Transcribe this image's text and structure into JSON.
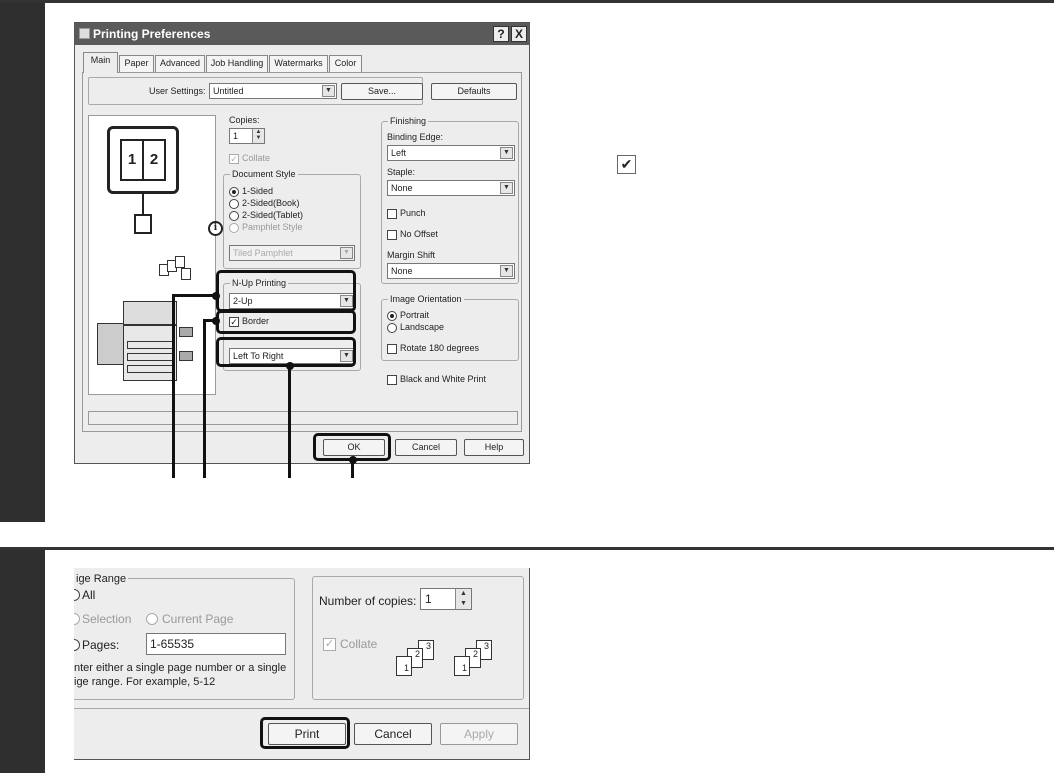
{
  "dialog1": {
    "title": "Printing Preferences",
    "help_button": "?",
    "close_button": "X",
    "tabs": [
      "Main",
      "Paper",
      "Advanced",
      "Job Handling",
      "Watermarks",
      "Color"
    ],
    "user_settings_label": "User Settings:",
    "user_settings_value": "Untitled",
    "save_button": "Save...",
    "defaults_button": "Defaults",
    "preview_pages": [
      "1",
      "2"
    ],
    "copies_label": "Copies:",
    "copies_value": "1",
    "collate_label": "Collate",
    "document_style_label": "Document Style",
    "document_style_options": [
      "1-Sided",
      "2-Sided(Book)",
      "2-Sided(Tablet)",
      "Pamphlet Style"
    ],
    "pamphlet_value": "Tiled Pamphlet",
    "info_icon_glyph": "i",
    "nup_label": "N-Up Printing",
    "nup_value": "2-Up",
    "border_label": "Border",
    "order_value": "Left To Right",
    "finishing_label": "Finishing",
    "binding_edge_label": "Binding Edge:",
    "binding_edge_value": "Left",
    "staple_label": "Staple:",
    "staple_value": "None",
    "punch_label": "Punch",
    "no_offset_label": "No Offset",
    "margin_shift_label": "Margin Shift",
    "margin_shift_value": "None",
    "orientation_label": "Image Orientation",
    "portrait_label": "Portrait",
    "landscape_label": "Landscape",
    "rotate_label": "Rotate 180 degrees",
    "bw_label": "Black and White Print",
    "ok_button": "OK",
    "cancel_button": "Cancel",
    "help_bottom_button": "Help"
  },
  "floating_check": "✔",
  "dialog2": {
    "page_range_label": "ige Range",
    "all_label": "All",
    "selection_label": "Selection",
    "current_page_label": "Current Page",
    "pages_label": "Pages:",
    "pages_value": "1-65535",
    "hint_line1": "nter either a single page number or a single",
    "hint_line2": "ige range.  For example, 5-12",
    "copies_label": "Number of copies:",
    "copies_value": "1",
    "collate_label": "Collate",
    "collate_sheets": [
      "1",
      "2",
      "3"
    ],
    "print_button": "Print",
    "cancel_button": "Cancel",
    "apply_button": "Apply"
  }
}
